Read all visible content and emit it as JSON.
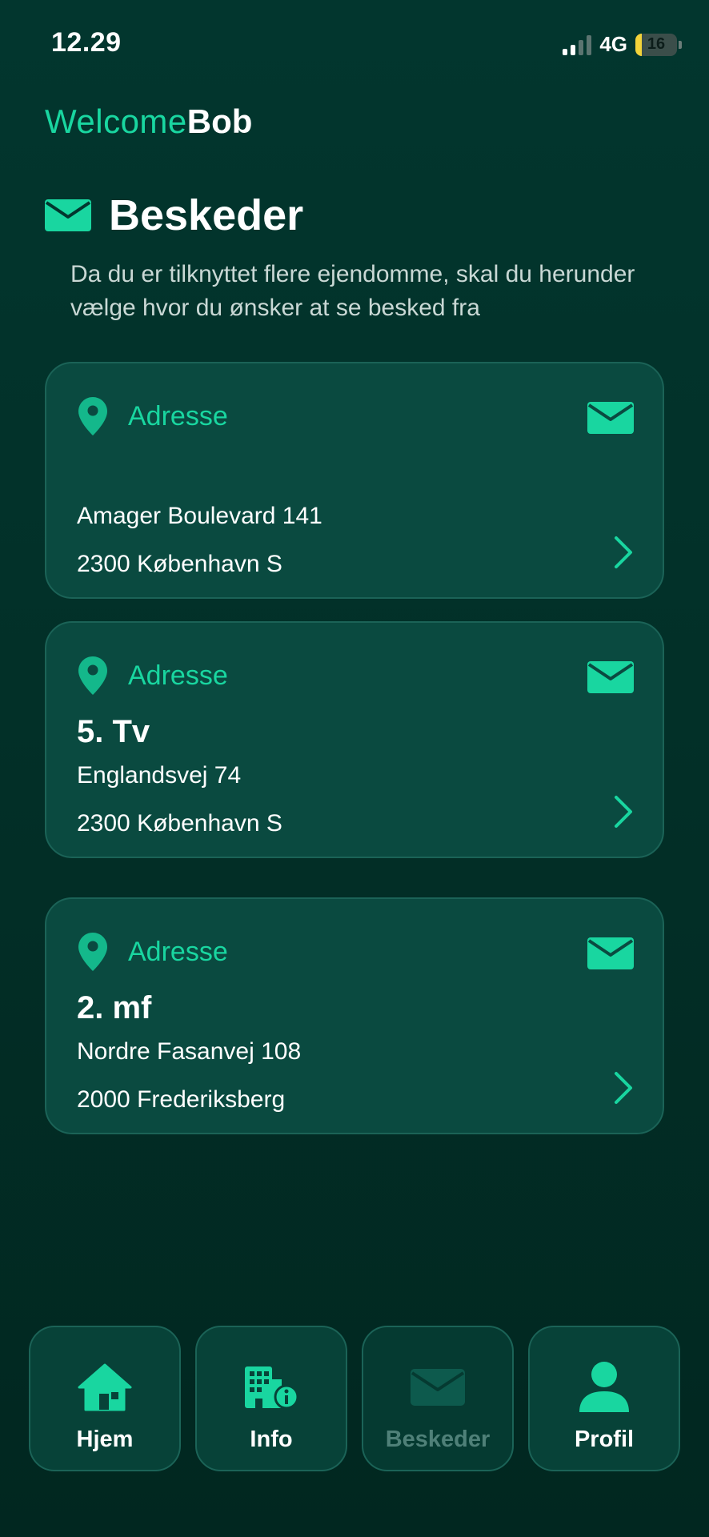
{
  "status": {
    "time": "12.29",
    "network": "4G",
    "battery": "16",
    "battery_level": 0.16
  },
  "brand": {
    "part1": "Welcome",
    "part2": "Bob"
  },
  "header": {
    "title": "Beskeder",
    "intro": "Da du er tilknyttet flere ejendomme, skal du herunder vælge hvor du ønsker at se besked fra"
  },
  "properties": [
    {
      "label": "Adresse",
      "unit": "",
      "street": "Amager Boulevard 141",
      "city": "2300 København S"
    },
    {
      "label": "Adresse",
      "unit": "5. Tv",
      "street": "Englandsvej 74",
      "city": "2300 København S"
    },
    {
      "label": "Adresse",
      "unit": "2. mf",
      "street": "Nordre Fasanvej 108",
      "city": "2000 Frederiksberg"
    }
  ],
  "nav": {
    "home": "Hjem",
    "info": "Info",
    "messages": "Beskeder",
    "profile": "Profil"
  },
  "colors": {
    "accent": "#19d6a0",
    "background": "#02362e",
    "card": "#0a4a40"
  }
}
